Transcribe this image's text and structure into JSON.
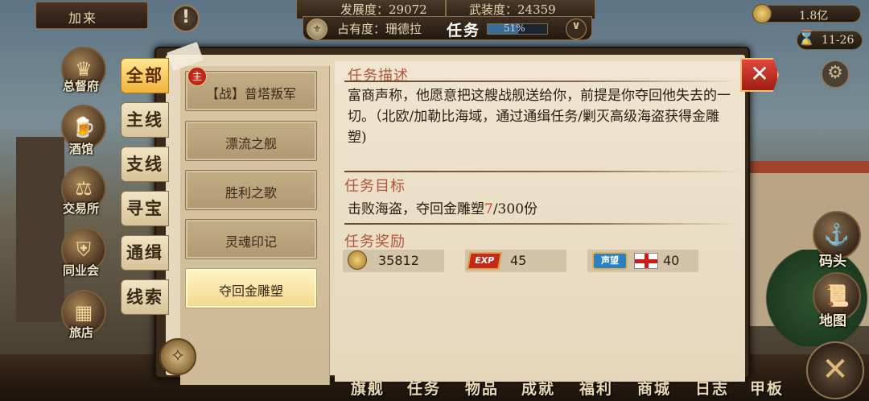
{
  "top": {
    "player_name": "加来",
    "development": "发展度：29072",
    "armament": "武装度：24359",
    "occupancy": "占有度：珊德拉",
    "panel_title": "任务",
    "progress_text": "51%",
    "progress_value": 0.51,
    "gold": "1.8亿",
    "date": "11-26"
  },
  "left_menu": [
    {
      "label": "总督府",
      "icon": "crown-icon"
    },
    {
      "label": "酒馆",
      "icon": "beer-icon"
    },
    {
      "label": "交易所",
      "icon": "scales-icon"
    },
    {
      "label": "同业会",
      "icon": "shield-icon"
    },
    {
      "label": "旅店",
      "icon": "bed-icon"
    }
  ],
  "categories": [
    "全部",
    "主线",
    "支线",
    "寻宝",
    "通缉",
    "线索"
  ],
  "active_category": "全部",
  "quests": [
    {
      "label": "【战】普塔叛军",
      "badge": "主"
    },
    {
      "label": "漂流之舰"
    },
    {
      "label": "胜利之歌"
    },
    {
      "label": "灵魂印记"
    },
    {
      "label": "夺回金雕塑",
      "selected": true
    }
  ],
  "detail": {
    "desc_title": "任务描述",
    "desc_text": "富商声称，他愿意把这艘战舰送给你，前提是你夺回他失去的一切。（北欧/加勒比海域，通过通缉任务/剿灭高级海盗获得金雕塑)",
    "goal_title": "任务目标",
    "goal_prefix": "击败海盗，夺回金雕塑",
    "goal_current": "7",
    "goal_total": "/300份",
    "reward_title": "任务奖励",
    "rewards": {
      "gold": "35812",
      "exp_label": "EXP",
      "exp": "45",
      "fame_label": "声望",
      "fame": "40"
    }
  },
  "right_menu": [
    {
      "label": "码头",
      "icon": "dock-icon"
    },
    {
      "label": "地图",
      "icon": "map-scroll-icon"
    }
  ],
  "bottom_nav": [
    "旗舰",
    "任务",
    "物品",
    "成就",
    "福利",
    "商城",
    "日志",
    "甲板"
  ],
  "colors": {
    "accent_red": "#d43a2a",
    "title_red": "#b0563a",
    "tab_active": "#f0b43a",
    "parchment": "#efe5d0"
  }
}
